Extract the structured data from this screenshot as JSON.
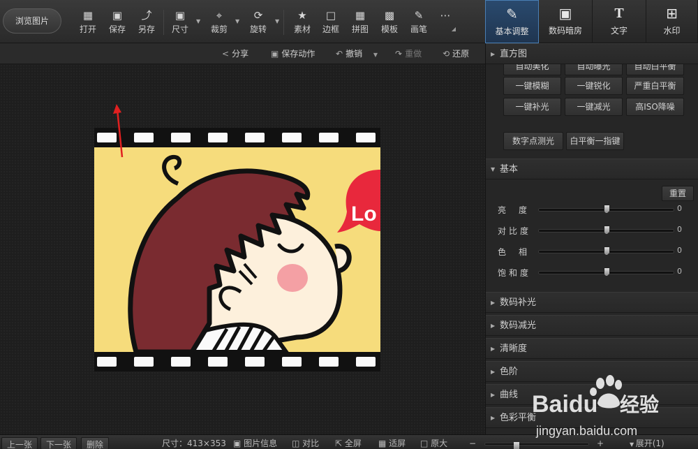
{
  "toolbar": {
    "browse_label": "浏览图片",
    "tools": [
      {
        "label": "打开",
        "icon": "open-image-icon"
      },
      {
        "label": "保存",
        "icon": "save-icon"
      },
      {
        "label": "另存",
        "icon": "save-as-icon"
      },
      {
        "label": "尺寸",
        "icon": "resize-icon"
      },
      {
        "label": "裁剪",
        "icon": "crop-icon"
      },
      {
        "label": "旋转",
        "icon": "rotate-icon"
      },
      {
        "label": "素材",
        "icon": "material-icon"
      },
      {
        "label": "边框",
        "icon": "frame-icon"
      },
      {
        "label": "拼图",
        "icon": "collage-icon"
      },
      {
        "label": "模板",
        "icon": "template-icon"
      },
      {
        "label": "画笔",
        "icon": "brush-icon"
      },
      {
        "label": "",
        "icon": "more-icon"
      }
    ]
  },
  "subbar": {
    "share": "分享",
    "save_action": "保存动作",
    "undo": "撤销",
    "redo": "重做",
    "restore": "还原"
  },
  "photo": {
    "bubble_text": "Lo"
  },
  "panel_tabs": [
    {
      "label": "基本调整",
      "icon": "adjust-icon",
      "active": true
    },
    {
      "label": "数码暗房",
      "icon": "darkroom-icon",
      "active": false
    },
    {
      "label": "文字",
      "icon": "text-icon",
      "active": false
    },
    {
      "label": "水印",
      "icon": "watermark-icon",
      "active": false
    }
  ],
  "panel": {
    "histogram_title": "直方图",
    "quick_buttons": [
      [
        "自动美化",
        "自动曝光",
        "自动白平衡"
      ],
      [
        "一键模糊",
        "一键锐化",
        "严重白平衡"
      ],
      [
        "一键补光",
        "一键减光",
        "高ISO降噪"
      ]
    ],
    "extra_buttons": [
      "数字点测光",
      "白平衡一指键"
    ],
    "basic_title": "基本",
    "reset_label": "重置",
    "sliders": [
      {
        "label": "亮度",
        "value": "0",
        "pos": 0.5
      },
      {
        "label": "对比度",
        "value": "0",
        "pos": 0.5
      },
      {
        "label": "色相",
        "value": "0",
        "pos": 0.5
      },
      {
        "label": "饱和度",
        "value": "0",
        "pos": 0.5
      }
    ],
    "sections": [
      "数码补光",
      "数码减光",
      "清晰度",
      "色阶",
      "曲线",
      "色彩平衡"
    ]
  },
  "statusbar": {
    "prev": "上一张",
    "next": "下一张",
    "delete": "删除",
    "size": "尺寸：413×353",
    "info": "图片信息",
    "compare": "对比",
    "fullscreen": "全屏",
    "fit": "适屏",
    "original": "原大",
    "zoom_minus": "−",
    "zoom_plus": "+",
    "expand": "展开(1)"
  },
  "watermark": {
    "brand": "Baidu",
    "brand_cn": "经验",
    "url": "jingyan.baidu.com"
  },
  "colors": {
    "accent": "#4a7fb5",
    "annotation_arrow": "#e02020",
    "photo_bg": "#f6dc7c",
    "hair": "#7a2b30",
    "skin": "#fdf0dc",
    "blush": "#f4a0a4",
    "bubble": "#e8283c"
  }
}
